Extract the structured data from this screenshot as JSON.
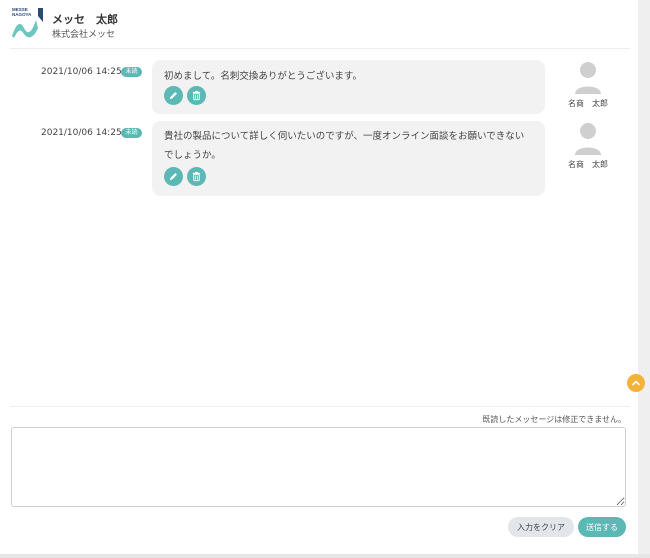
{
  "header": {
    "logo_text_line1": "MESSE",
    "logo_text_line2": "NAGOYA",
    "user_name": "メッセ　太郎",
    "company": "株式会社メッセ"
  },
  "messages": [
    {
      "timestamp": "2021/10/06 14:25",
      "status": "未読",
      "text": "初めまして。名刺交換ありがとうございます。",
      "sender": "名商　太郎"
    },
    {
      "timestamp": "2021/10/06 14:25",
      "status": "未読",
      "text": "貴社の製品について詳しく伺いたいのですが、一度オンライン面談をお願いできないでしょうか。",
      "sender": "名商　太郎"
    }
  ],
  "composer": {
    "notice": "既読したメッセージは修正できません。",
    "value": "",
    "clear_label": "入力をクリア",
    "send_label": "送信する"
  },
  "colors": {
    "accent": "#5bb8b4",
    "scroll_top": "#f3b23a",
    "bubble": "#f2f2f2"
  },
  "icons": [
    "pencil-icon",
    "trash-icon",
    "user-avatar-icon",
    "chevron-up-icon"
  ]
}
